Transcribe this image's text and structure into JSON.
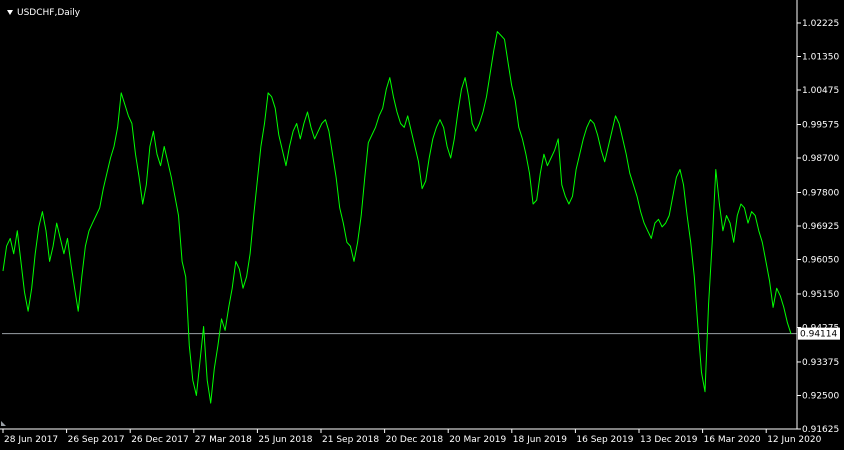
{
  "header": {
    "symbol_label": "USDCHF,Daily",
    "menu_icon": "triangle-down-icon"
  },
  "colors": {
    "background": "#000000",
    "price_line": "#00ff00",
    "axis": "#ffffff",
    "current_level_line": "#9aa0a6",
    "price_box_bg": "#ffffff",
    "price_box_text": "#000000"
  },
  "chart_data": {
    "type": "line",
    "symbol": "USDCHF",
    "timeframe": "Daily",
    "ylim": [
      0.91625,
      1.02825
    ],
    "y_ticks": [
      "1.02225",
      "1.01350",
      "1.00475",
      "0.99575",
      "0.98700",
      "0.97800",
      "0.96925",
      "0.96050",
      "0.95150",
      "0.94275",
      "0.93375",
      "0.92500",
      "0.91625"
    ],
    "x_ticks": [
      "28 Jun 2017",
      "26 Sep 2017",
      "26 Dec 2017",
      "27 Mar 2018",
      "25 Jun 2018",
      "21 Sep 2018",
      "20 Dec 2018",
      "20 Mar 2019",
      "18 Jun 2019",
      "16 Sep 2019",
      "13 Dec 2019",
      "16 Mar 2020",
      "12 Jun 2020"
    ],
    "current_price": 0.94114,
    "current_price_label": "0.94114",
    "series": [
      {
        "values": [
          0.9575,
          0.964,
          0.966,
          0.962,
          0.968,
          0.96,
          0.952,
          0.947,
          0.953,
          0.962,
          0.969,
          0.973,
          0.968,
          0.96,
          0.964,
          0.97,
          0.966,
          0.962,
          0.966,
          0.959,
          0.953,
          0.947,
          0.956,
          0.964,
          0.968,
          0.97,
          0.972,
          0.974,
          0.979,
          0.983,
          0.987,
          0.99,
          0.995,
          1.004,
          1.001,
          0.998,
          0.996,
          0.988,
          0.982,
          0.975,
          0.98,
          0.99,
          0.994,
          0.988,
          0.985,
          0.99,
          0.986,
          0.982,
          0.977,
          0.972,
          0.96,
          0.956,
          0.938,
          0.929,
          0.925,
          0.934,
          0.943,
          0.929,
          0.923,
          0.932,
          0.938,
          0.945,
          0.942,
          0.948,
          0.953,
          0.96,
          0.958,
          0.953,
          0.956,
          0.962,
          0.972,
          0.981,
          0.99,
          0.996,
          1.004,
          1.003,
          1.0,
          0.993,
          0.989,
          0.985,
          0.99,
          0.994,
          0.996,
          0.992,
          0.996,
          0.999,
          0.995,
          0.992,
          0.994,
          0.996,
          0.997,
          0.994,
          0.988,
          0.982,
          0.974,
          0.97,
          0.965,
          0.964,
          0.96,
          0.965,
          0.972,
          0.982,
          0.991,
          0.993,
          0.995,
          0.998,
          1.0,
          1.005,
          1.008,
          1.003,
          0.999,
          0.996,
          0.995,
          0.998,
          0.994,
          0.99,
          0.986,
          0.979,
          0.981,
          0.987,
          0.992,
          0.995,
          0.997,
          0.995,
          0.99,
          0.987,
          0.992,
          0.999,
          1.005,
          1.008,
          1.003,
          0.996,
          0.994,
          0.996,
          0.999,
          1.003,
          1.009,
          1.015,
          1.02,
          1.019,
          1.018,
          1.012,
          1.006,
          1.002,
          0.995,
          0.992,
          0.988,
          0.983,
          0.975,
          0.976,
          0.983,
          0.988,
          0.985,
          0.987,
          0.989,
          0.992,
          0.98,
          0.977,
          0.975,
          0.977,
          0.984,
          0.988,
          0.992,
          0.995,
          0.997,
          0.996,
          0.993,
          0.989,
          0.986,
          0.99,
          0.994,
          0.998,
          0.996,
          0.992,
          0.988,
          0.983,
          0.98,
          0.977,
          0.973,
          0.97,
          0.968,
          0.966,
          0.97,
          0.971,
          0.969,
          0.97,
          0.972,
          0.977,
          0.982,
          0.984,
          0.98,
          0.972,
          0.965,
          0.956,
          0.943,
          0.931,
          0.926,
          0.949,
          0.965,
          0.984,
          0.975,
          0.968,
          0.972,
          0.97,
          0.965,
          0.972,
          0.975,
          0.974,
          0.97,
          0.973,
          0.972,
          0.968,
          0.965,
          0.96,
          0.955,
          0.948,
          0.953,
          0.951,
          0.948,
          0.944,
          0.9411
        ]
      }
    ]
  }
}
